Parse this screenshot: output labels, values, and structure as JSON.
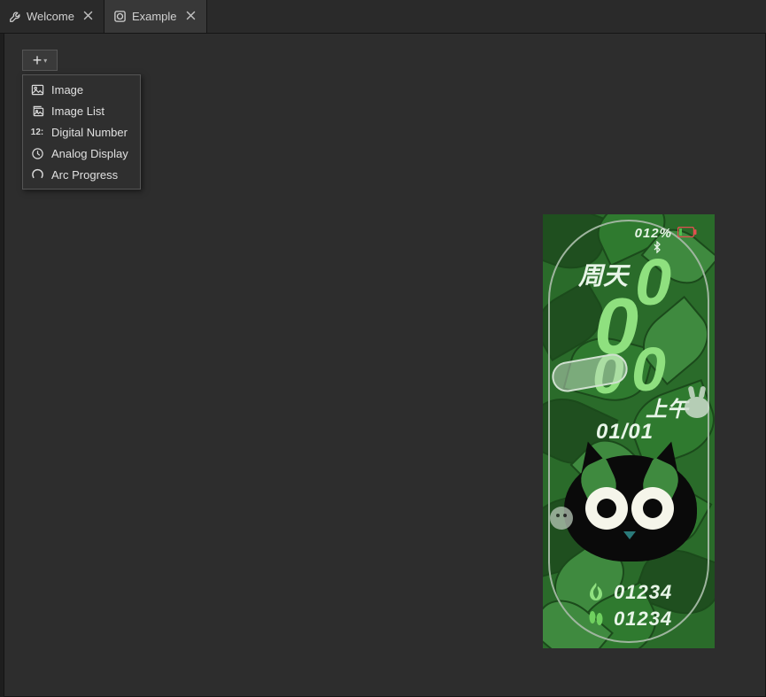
{
  "tabs": [
    {
      "label": "Welcome",
      "icon": "wrench-icon",
      "active": false
    },
    {
      "label": "Example",
      "icon": "watchface-icon",
      "active": true
    }
  ],
  "toolbar": {
    "add_button": {
      "icon": "plus-icon"
    },
    "dropdown": [
      {
        "label": "Image",
        "icon": "image-icon"
      },
      {
        "label": "Image List",
        "icon": "image-list-icon"
      },
      {
        "label": "Digital Number",
        "icon": "digital-number-icon"
      },
      {
        "label": "Analog Display",
        "icon": "clock-icon"
      },
      {
        "label": "Arc Progress",
        "icon": "arc-progress-icon"
      }
    ]
  },
  "watch_preview": {
    "battery_percent": "012%",
    "bluetooth_icon": "bluetooth-icon",
    "weekday": "周天",
    "hour_digits": "00",
    "minute_digits": "00",
    "ampm": "上午",
    "date": "01/01",
    "calories": {
      "icon": "flame-icon",
      "value": "01234"
    },
    "steps": {
      "icon": "footsteps-icon",
      "value": "01234"
    },
    "colors": {
      "bg_leaf_dark": "#1f4f1f",
      "bg_leaf_mid": "#2f7a2f",
      "bg_leaf_light": "#3f8a3f",
      "accent_green": "#8fe07f",
      "text_light": "#e8f5e8",
      "battery_outline": "#e05050"
    }
  }
}
